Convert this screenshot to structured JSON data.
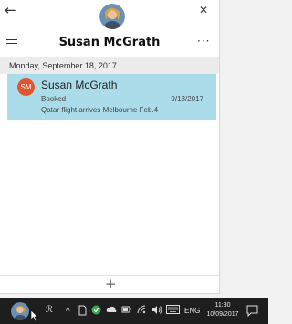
{
  "header": {
    "back_glyph": "←",
    "close_glyph": "✕",
    "title": "Susan McGrath",
    "more_glyph": "···"
  },
  "list": {
    "date_header": "Monday, September 18, 2017",
    "items": [
      {
        "initials": "SM",
        "name": "Susan McGrath",
        "status": "Booked",
        "date": "9/18/2017",
        "note": "Qatar flight arrives Melbourne Feb.4"
      }
    ]
  },
  "footer": {
    "add_glyph": "+"
  },
  "taskbar": {
    "people_glyph": "ℛ",
    "chevron_glyph": "^",
    "language": "ENG",
    "time": "11:30",
    "date": "10/09/2017"
  },
  "colors": {
    "accent_row": "#aadcea",
    "badge": "#e1552e",
    "taskbar": "#1e1e1e"
  }
}
